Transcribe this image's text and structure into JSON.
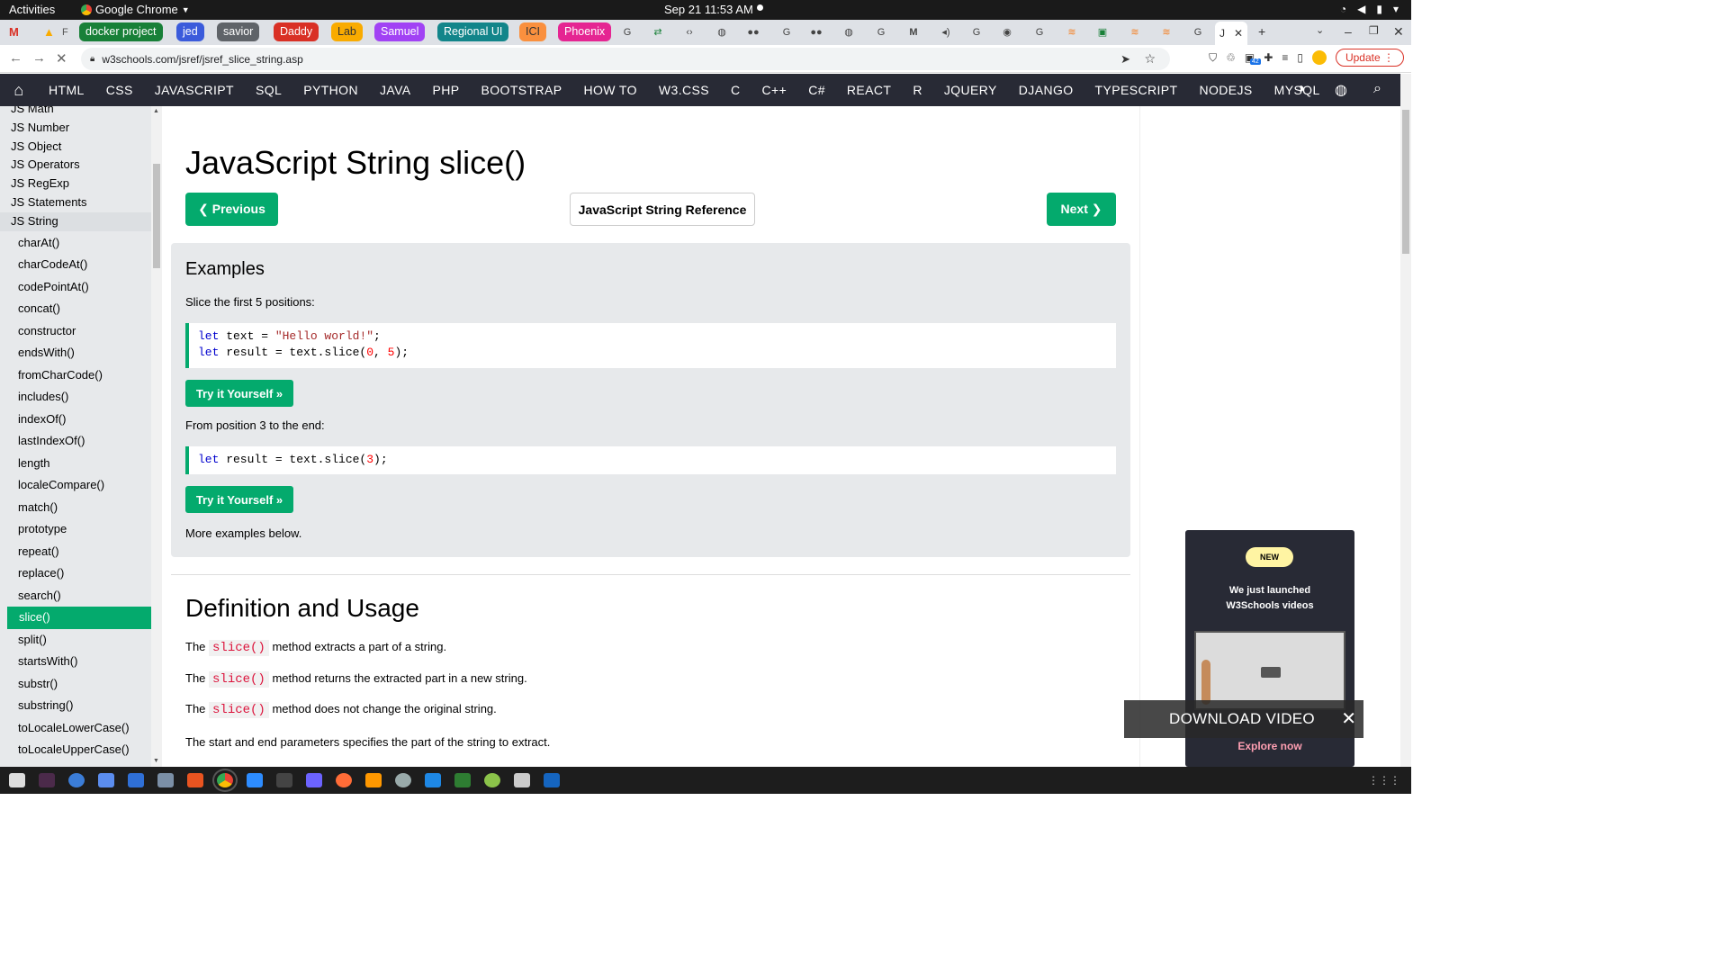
{
  "system": {
    "activities": "Activities",
    "app_name": "Google Chrome",
    "clock": "Sep 21  11:53 AM"
  },
  "bookmarks": [
    {
      "label": "docker project",
      "color": "#188038"
    },
    {
      "label": "jed",
      "color": "#3b5bdb"
    },
    {
      "label": "savior",
      "color": "#5f6368"
    },
    {
      "label": "Daddy",
      "color": "#d93025"
    },
    {
      "label": "Lab",
      "color": "#f9ab00"
    },
    {
      "label": "Samuel",
      "color": "#a142f4"
    },
    {
      "label": "Regional UI",
      "color": "#12858a"
    },
    {
      "label": "ICI",
      "color": "#fa903e"
    },
    {
      "label": "Phoenix",
      "color": "#e52592"
    }
  ],
  "tabs": {
    "active_label": "J",
    "new_tab": "+"
  },
  "address_bar": {
    "url": "w3schools.com/jsref/jsref_slice_string.asp",
    "update_label": "Update",
    "extension_badge": "42"
  },
  "w3nav": {
    "links": [
      "HTML",
      "CSS",
      "JAVASCRIPT",
      "SQL",
      "PYTHON",
      "JAVA",
      "PHP",
      "BOOTSTRAP",
      "HOW TO",
      "W3.CSS",
      "C",
      "C++",
      "C#",
      "REACT",
      "R",
      "JQUERY",
      "DJANGO",
      "TYPESCRIPT",
      "NODEJS",
      "MYSQL"
    ]
  },
  "sidebar": {
    "top_items": [
      "JS Math",
      "JS Number",
      "JS Object",
      "JS Operators",
      "JS RegExp",
      "JS Statements",
      "JS String"
    ],
    "sub_items": [
      "charAt()",
      "charCodeAt()",
      "codePointAt()",
      "concat()",
      "constructor",
      "endsWith()",
      "fromCharCode()",
      "includes()",
      "indexOf()",
      "lastIndexOf()",
      "length",
      "localeCompare()",
      "match()",
      "prototype",
      "repeat()",
      "replace()",
      "search()",
      "slice()",
      "split()",
      "startsWith()",
      "substr()",
      "substring()",
      "toLocaleLowerCase()",
      "toLocaleUpperCase()"
    ],
    "active_item": "slice()"
  },
  "main": {
    "title": "JavaScript String slice()",
    "previous_label": "❮ Previous",
    "reference_label": "JavaScript String Reference",
    "next_label": "Next ❯",
    "examples_heading": "Examples",
    "example1_desc": "Slice the first 5 positions:",
    "example1_line1": {
      "kw": "let",
      "rest": " text = ",
      "str": "\"Hello world!\"",
      "end": ";"
    },
    "example1_line2": {
      "kw": "let",
      "rest": " result = text.slice(",
      "n1": "0",
      "sep": ", ",
      "n2": "5",
      "end": ");"
    },
    "tryit_label": "Try it Yourself »",
    "example2_desc": "From position 3 to the end:",
    "example2_line1": {
      "kw": "let",
      "rest": " result = text.slice(",
      "n1": "3",
      "end": ");"
    },
    "more_examples": "More examples below.",
    "definition_heading": "Definition and Usage",
    "paras": [
      {
        "pre": "The ",
        "code": "slice()",
        "post": " method extracts a part of a string."
      },
      {
        "pre": "The ",
        "code": "slice()",
        "post": " method returns the extracted part in a new string."
      },
      {
        "pre": "The ",
        "code": "slice()",
        "post": " method does not change the original string."
      }
    ],
    "params_text": "The start and end parameters specifies the part of the string to extract."
  },
  "promo": {
    "badge": "NEW",
    "headline_line1": "We just launched",
    "headline_line2": "W3Schools videos",
    "explore": "Explore now"
  },
  "download_bar": {
    "label": "DOWNLOAD VIDEO"
  }
}
